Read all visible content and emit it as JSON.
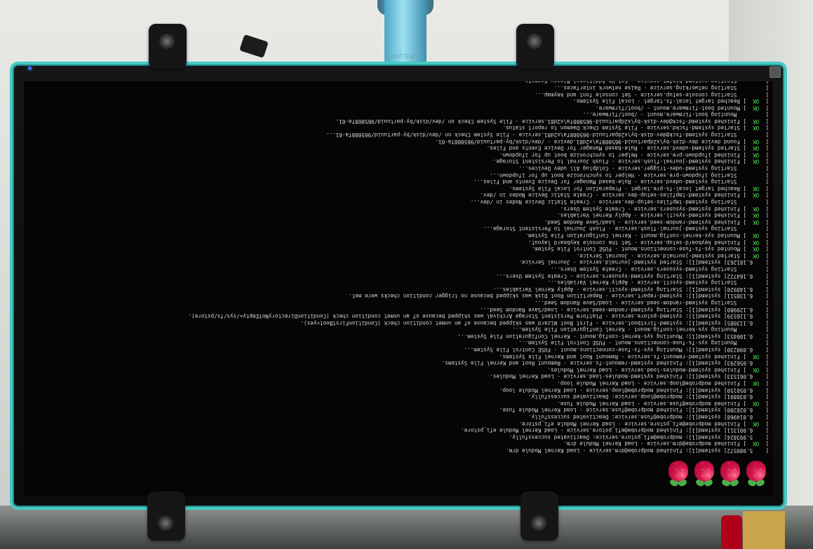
{
  "brand": "SAMSUNG",
  "status_label": "OK",
  "colors": {
    "bezel_accent": "#46c9c4",
    "ok_green": "#4fe04f",
    "terminal_text": "#d8d8d8",
    "power_led": "#2e78ff"
  },
  "icons": [
    "raspberry-pi-logo",
    "raspberry-pi-logo",
    "raspberry-pi-logo",
    "raspberry-pi-logo"
  ],
  "boot_log": [
    {
      "status": "",
      "text": "    5.980572] systemd[1]: Finished modprobe@drm.service - Load Kernel Module drm."
    },
    {
      "status": "OK",
      "text": "Finished modprobe@drm.service - Load Kernel Module drm."
    },
    {
      "status": "",
      "text": "    5.993824] systemd[1]: modprobe@efi_pstore.service: Deactivated successfully."
    },
    {
      "status": "",
      "text": "    6.001311] systemd[1]: Finished modprobe@efi_pstore.service - Load Kernel Module efi_pstore."
    },
    {
      "status": "OK",
      "text": "Finished modprobe@efi_pstore.service - Load Kernel Module efi_pstore."
    },
    {
      "status": "",
      "text": "    6.014968] systemd[1]: modprobe@fuse.service: Deactivated successfully."
    },
    {
      "status": "",
      "text": "    6.028280] systemd[1]: Finished modprobe@fuse.service - Load Kernel Module fuse."
    },
    {
      "status": "OK",
      "text": "Finished modprobe@fuse.service - Load Kernel Module fuse."
    },
    {
      "status": "",
      "text": "    6.038891] systemd[1]: modprobe@loop.service: Deactivated successfully."
    },
    {
      "status": "",
      "text": "    6.050150] systemd[1]: Finished modprobe@loop.service - Load Kernel Module loop."
    },
    {
      "status": "OK",
      "text": "Finished modprobe@loop.service - Load Kernel Module loop."
    },
    {
      "status": "",
      "text": "    6.061533] systemd[1]: Finished systemd-modules-load.service - Load Kernel Modules."
    },
    {
      "status": "OK",
      "text": "Finished systemd-modules-load.service - Load Kernel Modules."
    },
    {
      "status": "",
      "text": "    6.056293] systemd[1]: Finished systemd-remount-fs.service - Remount Root and Kernel File Systems."
    },
    {
      "status": "OK",
      "text": "Finished systemd-remount-fs.service - Remount Root and Kernel File Systems."
    },
    {
      "status": "",
      "text": "    6.090230] systemd[1]: Mounting sys-fs-fuse-connections.mount - FUSE Control File System..."
    },
    {
      "status": "",
      "text": "         Mounting sys-fs-fuse-connections.mount - FUSE Control File System..."
    },
    {
      "status": "",
      "text": "    6.100453] systemd[1]: Mounting sys-kernel-config.mount - Kernel Configuration File System..."
    },
    {
      "status": "",
      "text": "         Mounting sys-kernel-config.mount - Kernel Configuration File System..."
    },
    {
      "status": "",
      "text": "    6.113085] systemd[1]: systemd-firstboot.service - First Boot Wizard was skipped because of an unmet condition check (ConditionFirstBoot=yes)."
    },
    {
      "status": "",
      "text": "    6.116539] systemd[1]: systemd-pstore.service - Platform Persistent Storage Archival was skipped because of an unmet condition check (ConditionDirectoryNotEmpty=/sys/fs/pstore)."
    },
    {
      "status": "",
      "text": "    6.129980] systemd[1]: Starting systemd-random-seed.service - Load/Save Random Seed..."
    },
    {
      "status": "",
      "text": "         Starting systemd-random-seed.service - Load/Save Random Seed..."
    },
    {
      "status": "",
      "text": "    6.138511] systemd[1]: systemd-repart.service - Repartition Root Disk was skipped because no trigger condition checks were met."
    },
    {
      "status": "",
      "text": "    6.148920] systemd[1]: Starting systemd-sysctl.service - Apply Kernel Variables..."
    },
    {
      "status": "",
      "text": "         Starting systemd-sysctl.service - Apply Kernel Variables..."
    },
    {
      "status": "",
      "text": "    6.164722] systemd[1]: Starting systemd-sysusers.service - Create System Users..."
    },
    {
      "status": "",
      "text": "         Starting systemd-sysusers.service - Create System Users..."
    },
    {
      "status": "",
      "text": "    6.181263] systemd[1]: Started systemd-journald.service - Journal Service."
    },
    {
      "status": "OK",
      "text": "Started systemd-journald.service - Journal Service."
    },
    {
      "status": "OK",
      "text": "Mounted sys-fs-fuse-connections.mount - FUSE Control File System."
    },
    {
      "status": "OK",
      "text": "Finished keyboard-setup.service - Set the console keyboard layout."
    },
    {
      "status": "OK",
      "text": "Mounted sys-kernel-config.mount - Kernel Configuration File System."
    },
    {
      "status": "",
      "text": "         Starting systemd-journal-flush.service - Flush Journal to Persistent Storage..."
    },
    {
      "status": "OK",
      "text": "Finished systemd-random-seed.service - Load/Save Random Seed."
    },
    {
      "status": "OK",
      "text": "Finished systemd-sysctl.service - Apply Kernel Variables."
    },
    {
      "status": "OK",
      "text": "Finished systemd-sysusers.service - Create System Users."
    },
    {
      "status": "",
      "text": "         Starting systemd-tmpfiles-setup-dev.service - Create Static Device Nodes in /dev..."
    },
    {
      "status": "OK",
      "text": "Finished systemd-tmpfiles-setup-dev.service - Create Static Device Nodes in /dev."
    },
    {
      "status": "OK",
      "text": "Reached target local-fs-pre.target - Preparation for Local File Systems."
    },
    {
      "status": "",
      "text": "         Starting systemd-udevd.service - Rule-based Manager for Device Events and Files..."
    },
    {
      "status": "",
      "text": "         Starting ifupdown-pre.service - Helper to synchronize boot up for ifupdown..."
    },
    {
      "status": "",
      "text": "         Starting systemd-udev-trigger.service - Coldplug All udev Devices..."
    },
    {
      "status": "OK",
      "text": "Finished systemd-journal-flush.service - Flush Journal to Persistent Storage."
    },
    {
      "status": "OK",
      "text": "Finished ifupdown-pre.service - Helper to synchronize boot up for ifupdown."
    },
    {
      "status": "OK",
      "text": "Started systemd-udevd.service - Rule-based Manager for Device Events and Files."
    },
    {
      "status": "OK",
      "text": "Found device dev-disk-by\\x2dpartuuid-965008fa\\x2d01.device - /dev/disk/by-partuuid/965008fa-01."
    },
    {
      "status": "",
      "text": "         Starting systemd-fsck@dev-disk-by\\x2dpartuuid-965008fa\\x2d01.service - File System Check on /dev/disk/by-partuuid/965008fa-01..."
    },
    {
      "status": "OK",
      "text": "Started systemd-fsckd.service - File System Check Daemon to report status."
    },
    {
      "status": "OK",
      "text": "Finished systemd-fsck@dev-disk-by\\x2dpartuuid-965008fa\\x2d01.service - File System Check on /dev/disk/by-partuuid/965008fa-01."
    },
    {
      "status": "",
      "text": "         Mounting boot-firmware.mount - /boot/firmware..."
    },
    {
      "status": "OK",
      "text": "Mounted boot-firmware.mount - /boot/firmware."
    },
    {
      "status": "OK",
      "text": "Reached target local-fs.target - Local File Systems."
    },
    {
      "status": "",
      "text": "         Starting console-setup.service - Set console font and keymap..."
    },
    {
      "status": "",
      "text": "         Starting networking.service - Raise network interfaces..."
    },
    {
      "status": "",
      "text": "         Starting systemd-binfmt.service - Set Up Additional Binary Formats..."
    },
    {
      "status": "",
      "text": "         Starting systemd-machine-id-commit.service - Commit a transient machine-id on disk..."
    },
    {
      "status": "",
      "text": "         Starting systemd-tmpfiles-setup.service - Create Volatile Files and Directories..."
    },
    {
      "status": "OK",
      "text": "Finished console-setup.service - Set console font and keymap."
    },
    {
      "status": "",
      "text": "         Mounting proc-sys-fs-binfmt_misc.mount - Arbitrary Executable File Formats File System..."
    },
    {
      "status": "OK",
      "text": "Mounted proc-sys-fs-binfmt_misc.mount - Arbitrary Executable File Formats File System."
    }
  ]
}
